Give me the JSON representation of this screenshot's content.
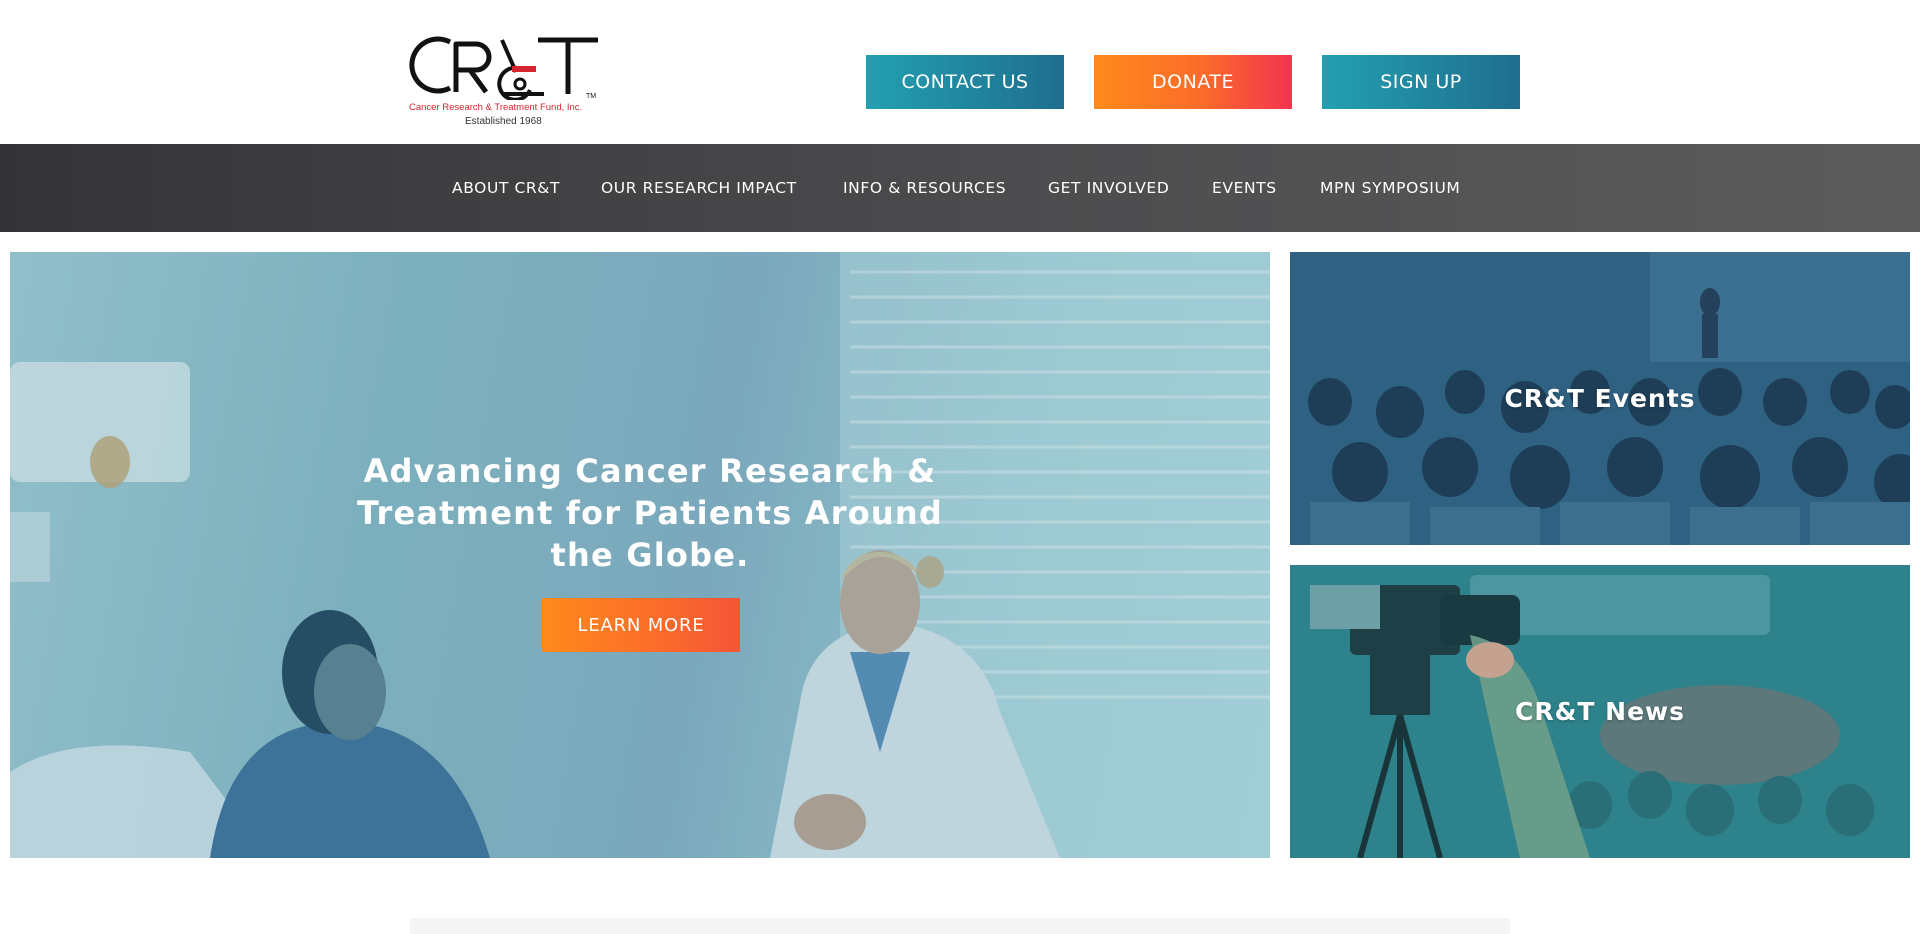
{
  "header": {
    "logo": {
      "mark_text": "CR&T",
      "tagline": "Cancer Research & Treatment Fund, Inc.",
      "established": "Established 1968",
      "trademark": "TM"
    },
    "buttons": {
      "contact": "CONTACT US",
      "donate": "DONATE",
      "signup": "SIGN UP"
    }
  },
  "nav": {
    "items": [
      {
        "label": "ABOUT CR&T"
      },
      {
        "label": "OUR RESEARCH IMPACT"
      },
      {
        "label": "INFO & RESOURCES"
      },
      {
        "label": "GET INVOLVED"
      },
      {
        "label": "EVENTS"
      },
      {
        "label": "MPN SYMPOSIUM"
      }
    ]
  },
  "hero": {
    "title": "Advancing Cancer Research & Treatment for Patients Around the Globe.",
    "button": "LEARN MORE",
    "image": "doctor-talking-with-patient-photo"
  },
  "cards": {
    "events": {
      "title": "CR&T Events",
      "image": "conference-audience-photo"
    },
    "news": {
      "title": "CR&T News",
      "image": "video-camera-recording-event-photo"
    }
  },
  "colors": {
    "teal_button": "#22a0b0",
    "navy_button": "#1f6e8f",
    "orange": "#ff8a1c",
    "red": "#f2334f",
    "nav_bg": "#3a393b",
    "logo_red": "#d4252f"
  }
}
